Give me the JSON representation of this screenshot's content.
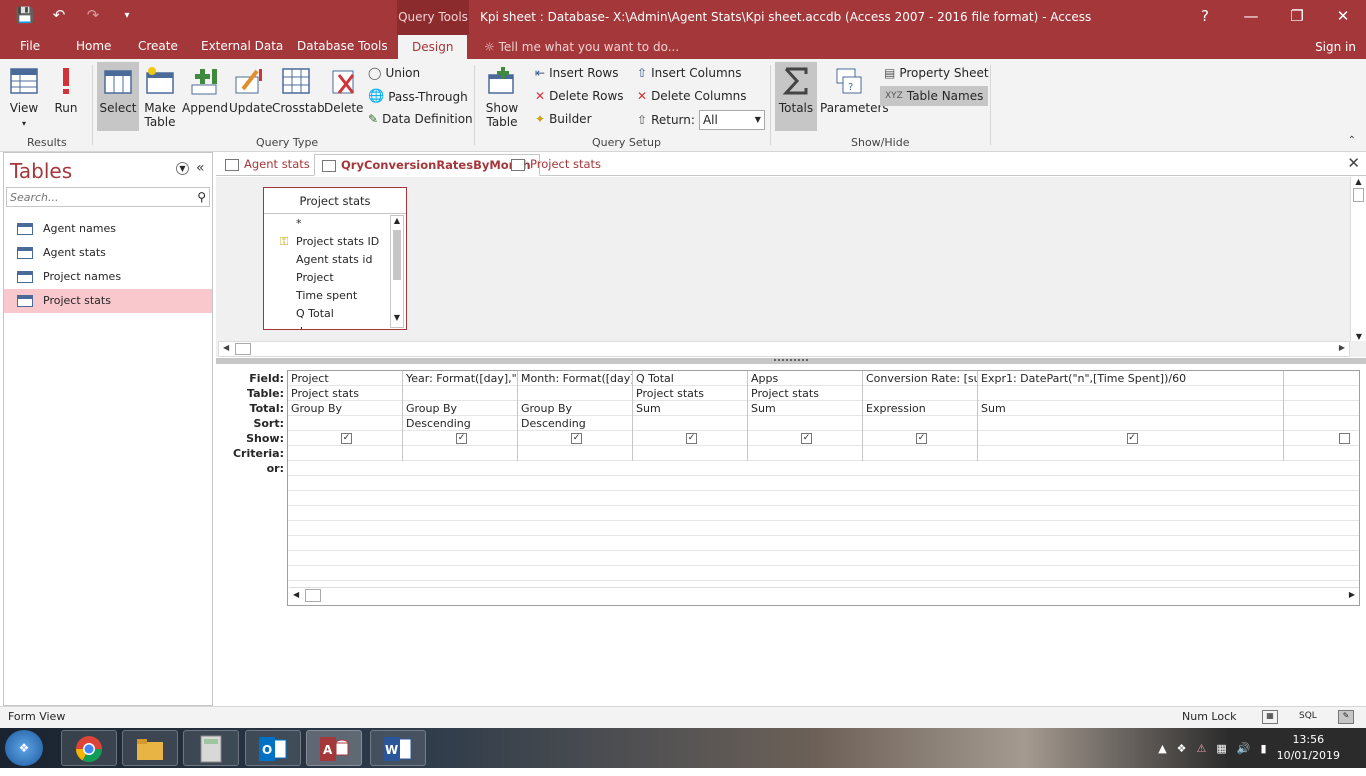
{
  "titlebar": {
    "context_tab": "Query Tools",
    "title": "Kpi sheet : Database- X:\\Admin\\Agent Stats\\Kpi sheet.accdb (Access 2007 - 2016 file format) - Access",
    "help": "?",
    "minimize": "—",
    "restore": "❐",
    "close": "✕"
  },
  "menu": {
    "tabs": [
      "File",
      "Home",
      "Create",
      "External Data",
      "Database Tools",
      "Design"
    ],
    "tell_me": "Tell me what you want to do...",
    "sign_in": "Sign in"
  },
  "ribbon": {
    "results": {
      "label": "Results",
      "view": "View",
      "run": "Run"
    },
    "query_type": {
      "label": "Query Type",
      "select": "Select",
      "make_table_1": "Make",
      "make_table_2": "Table",
      "append": "Append",
      "update": "Update",
      "crosstab": "Crosstab",
      "delete": "Delete",
      "union": "Union",
      "pass_through": "Pass-Through",
      "data_definition": "Data Definition"
    },
    "query_setup": {
      "label": "Query Setup",
      "show_table_1": "Show",
      "show_table_2": "Table",
      "insert_rows": "Insert Rows",
      "delete_rows": "Delete Rows",
      "builder": "Builder",
      "insert_columns": "Insert Columns",
      "delete_columns": "Delete Columns",
      "return_label": "Return:",
      "return_value": "All"
    },
    "show_hide": {
      "label": "Show/Hide",
      "totals": "Totals",
      "parameters": "Parameters",
      "property_sheet": "Property Sheet",
      "table_names": "Table Names"
    }
  },
  "nav": {
    "title": "Tables",
    "search_placeholder": "Search...",
    "items": [
      "Agent names",
      "Agent stats",
      "Project names",
      "Project stats"
    ]
  },
  "doctabs": [
    "Agent stats",
    "QryConversionRatesByMonth",
    "Project stats"
  ],
  "table_box": {
    "title": "Project stats",
    "fields": [
      "*",
      "Project stats ID",
      "Agent stats id",
      "Project",
      "Time spent",
      "Q Total",
      "day"
    ]
  },
  "grid": {
    "row_labels": [
      "Field:",
      "Table:",
      "Total:",
      "Sort:",
      "Show:",
      "Criteria:",
      "or:"
    ],
    "columns": [
      {
        "field": "Project",
        "table": "Project stats",
        "total": "Group By",
        "sort": "",
        "show": true
      },
      {
        "field": "Year: Format([day],\"yyyy\")",
        "table": "",
        "total": "Group By",
        "sort": "Descending",
        "show": true
      },
      {
        "field": "Month: Format([day],\"",
        "table": "",
        "total": "Group By",
        "sort": "Descending",
        "show": true
      },
      {
        "field": "Q Total",
        "table": "Project stats",
        "total": "Sum",
        "sort": "",
        "show": true
      },
      {
        "field": "Apps",
        "table": "Project stats",
        "total": "Sum",
        "sort": "",
        "show": true
      },
      {
        "field": "Conversion Rate: [sum",
        "table": "",
        "total": "Expression",
        "sort": "",
        "show": true
      },
      {
        "field": "Expr1: DatePart(\"n\",[Time Spent])/60",
        "table": "",
        "total": "Sum",
        "sort": "",
        "show": true
      },
      {
        "field": "",
        "table": "",
        "total": "",
        "sort": "",
        "show": false
      }
    ]
  },
  "status": {
    "left": "Form View",
    "num_lock": "Num Lock",
    "sql": "SQL"
  },
  "taskbar": {
    "time": "13:56",
    "date": "10/01/2019"
  }
}
